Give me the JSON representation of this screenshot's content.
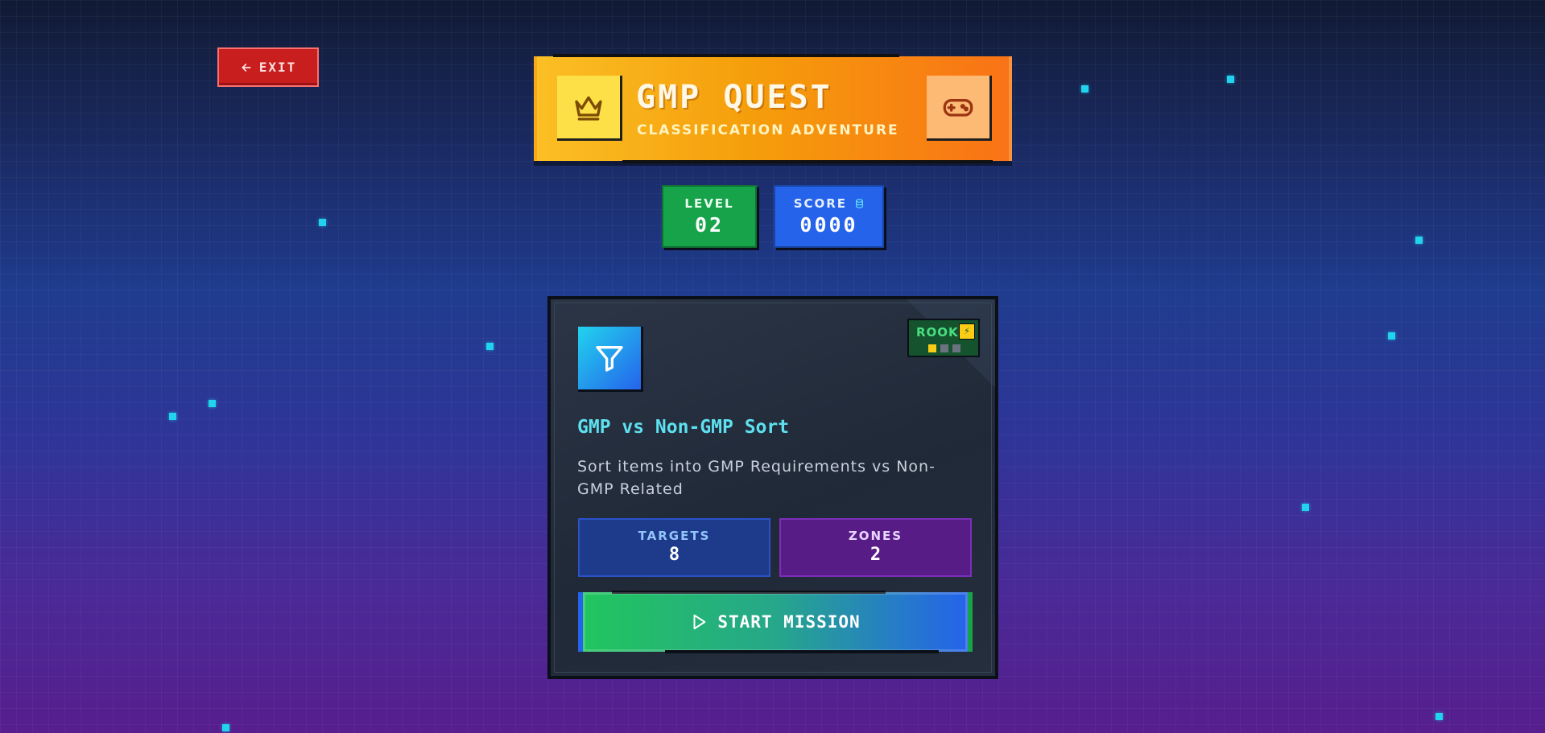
{
  "exit": {
    "label": "EXIT",
    "icon": "arrow-left-icon"
  },
  "banner": {
    "title": "GMP QUEST",
    "subtitle": "CLASSIFICATION ADVENTURE",
    "left_icon": "crown-icon",
    "right_icon": "gamepad-icon"
  },
  "stats": {
    "level_label": "LEVEL",
    "level_value": "02",
    "score_label": "SCORE",
    "score_value": "0000",
    "score_icon": "coin-stack-icon"
  },
  "mission": {
    "icon": "filter-icon",
    "badge_label": "ROOKIE",
    "difficulty": {
      "filled": 1,
      "total": 3
    },
    "title": "GMP vs Non-GMP Sort",
    "description": "Sort items into GMP Requirements vs Non-GMP Related",
    "targets_label": "TARGETS",
    "targets_value": "8",
    "zones_label": "ZONES",
    "zones_value": "2",
    "start_label": "START MISSION",
    "start_icon": "play-icon"
  },
  "colors": {
    "accent_cyan": "#22d3ee",
    "banner_orange": "#f59e0b",
    "level_green": "#16a34a",
    "score_blue": "#2563eb",
    "exit_red": "#c81e1e"
  }
}
